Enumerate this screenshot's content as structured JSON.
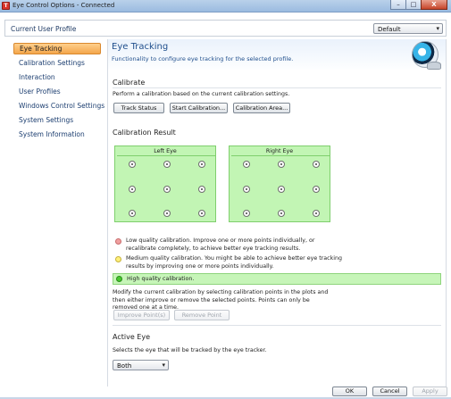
{
  "window": {
    "title": "Eye Control Options - Connected",
    "app_icon_letter": "T",
    "minimize": "–",
    "maximize": "□",
    "close": "X"
  },
  "profile_bar": {
    "label": "Current User Profile",
    "selected_profile": "Default"
  },
  "sidebar": {
    "items": [
      {
        "label": "Eye Tracking",
        "active": true
      },
      {
        "label": "Calibration Settings",
        "active": false
      },
      {
        "label": "Interaction",
        "active": false
      },
      {
        "label": "User Profiles",
        "active": false
      },
      {
        "label": "Windows Control Settings",
        "active": false
      },
      {
        "label": "System Settings",
        "active": false
      },
      {
        "label": "System Information",
        "active": false
      }
    ]
  },
  "main": {
    "title": "Eye Tracking",
    "subtitle": "Functionality to configure eye tracking for the selected profile.",
    "icon": "eye-camera-icon",
    "calibrate": {
      "heading": "Calibrate",
      "description": "Perform a calibration based on the current calibration settings.",
      "buttons": {
        "track_status": "Track Status",
        "start_calibration": "Start Calibration...",
        "calibration_area": "Calibration Area..."
      }
    },
    "calibration_result": {
      "heading": "Calibration Result",
      "left_eye": "Left Eye",
      "right_eye": "Right Eye",
      "plot_color": "#c2f5b4",
      "points_per_eye": 9
    },
    "legend": {
      "low": "Low quality calibration. Improve one or more points individually, or recalibrate completely, to achieve better eye tracking results.",
      "medium": "Medium quality calibration. You might be able to achieve better eye tracking results by improving one or more points individually.",
      "high": "High quality calibration.",
      "colors": {
        "low": "#f0a0a0",
        "medium": "#fff07a",
        "high": "#48c830"
      }
    },
    "modify_text": "Modify the current calibration by selecting calibration points in the plots and then either improve or remove the selected points. Points can only be removed one at a time.",
    "improve_button": "Improve Point(s)",
    "remove_button": "Remove Point",
    "active_eye": {
      "heading": "Active Eye",
      "description": "Selects the eye that will be tracked by the eye tracker.",
      "selected": "Both"
    }
  },
  "footer": {
    "ok": "OK",
    "cancel": "Cancel",
    "apply": "Apply"
  }
}
